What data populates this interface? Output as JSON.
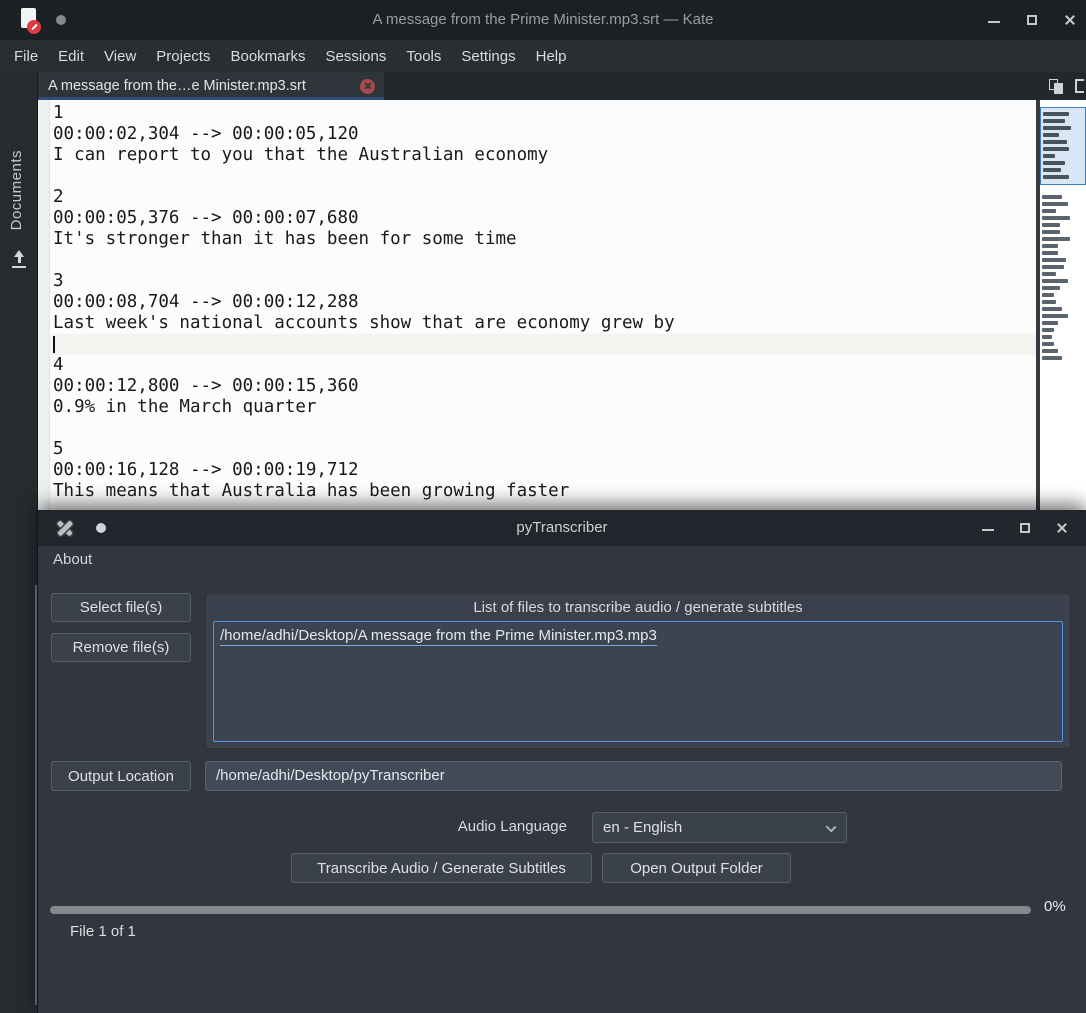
{
  "kate": {
    "titlebar": {
      "title": "A message from the Prime Minister.mp3.srt — Kate"
    },
    "menu": {
      "items": [
        "File",
        "Edit",
        "View",
        "Projects",
        "Bookmarks",
        "Sessions",
        "Tools",
        "Settings",
        "Help"
      ]
    },
    "tab": {
      "label": "A message from the…e Minister.mp3.srt"
    },
    "sidebar": {
      "label": "Documents"
    },
    "subtitles": [
      {
        "index": "1",
        "time": "00:00:02,304 --> 00:00:05,120",
        "text": "I can report to you that the Australian economy",
        "blank_class": "code-line blank"
      },
      {
        "index": "2",
        "time": "00:00:05,376 --> 00:00:07,680",
        "text": "It's stronger than it has been for some time",
        "blank_class": "code-line blank"
      },
      {
        "index": "3",
        "time": "00:00:08,704 --> 00:00:12,288",
        "text": "Last week's national accounts show that are economy grew by",
        "blank_class": "code-line blank current-line"
      },
      {
        "index": "4",
        "time": "00:00:12,800 --> 00:00:15,360",
        "text": "0.9% in the March quarter",
        "blank_class": "code-line blank"
      },
      {
        "index": "5",
        "time": "00:00:16,128 --> 00:00:19,712",
        "text": "This means that Australia has been growing faster",
        "blank_class": "code-line blank"
      }
    ],
    "minimap": {
      "visible_rows": [
        26,
        22,
        28,
        16,
        24,
        26,
        12,
        22,
        18,
        26
      ],
      "rows": [
        20,
        26,
        14,
        28,
        18,
        18,
        28,
        16,
        16,
        24,
        22,
        14,
        26,
        18,
        12,
        14,
        20,
        26,
        16,
        12,
        10,
        12,
        16,
        20
      ]
    }
  },
  "pytranscriber": {
    "titlebar": {
      "title": "pyTranscriber"
    },
    "menu": {
      "about": "About"
    },
    "buttons": {
      "select": "Select file(s)",
      "remove": "Remove file(s)",
      "output_location": "Output Location",
      "transcribe": "Transcribe Audio / Generate Subtitles",
      "open_output": "Open Output Folder"
    },
    "file_group": {
      "title": "List of files to transcribe audio / generate subtitles",
      "files": [
        "/home/adhi/Desktop/A message from the Prime Minister.mp3.mp3"
      ]
    },
    "output_path": "/home/adhi/Desktop/pyTranscriber",
    "audio_language": {
      "label": "Audio Language",
      "selected": "en - English"
    },
    "progress": {
      "percent": "0%",
      "status": "File 1 of 1"
    }
  },
  "colors": {
    "accent_blue": "#5294e2",
    "tab_underline": "#2d4e77",
    "tab_close_red": "#a84a4d",
    "minimap_highlight": "#d8e6f6",
    "editor_background": "#fcfcfd"
  }
}
